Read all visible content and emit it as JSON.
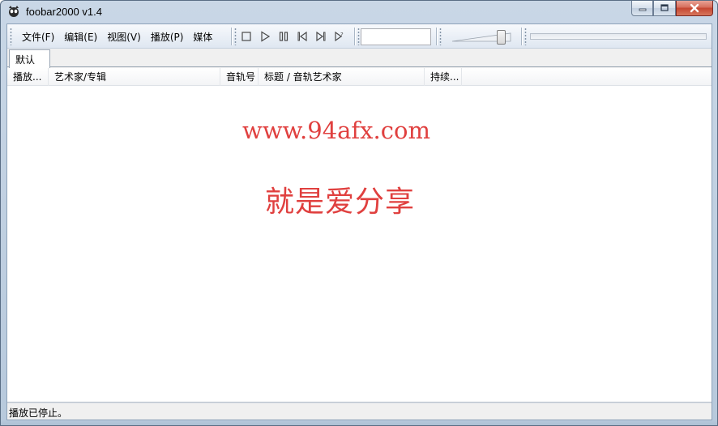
{
  "window": {
    "title": "foobar2000 v1.4"
  },
  "menu": {
    "items": [
      "文件(F)",
      "编辑(E)",
      "视图(V)",
      "播放(P)",
      "媒体"
    ]
  },
  "transport": {
    "buttons": [
      "stop-icon",
      "play-icon",
      "pause-icon",
      "previous-icon",
      "next-icon",
      "random-icon"
    ]
  },
  "volume": {
    "level": 0.85
  },
  "seek": {
    "position": 0
  },
  "tabs": [
    {
      "label": "默认",
      "active": true
    }
  ],
  "playlist": {
    "columns": [
      "播放...",
      "艺术家/专辑",
      "音轨号",
      "标题 / 音轨艺术家",
      "持续..."
    ],
    "rows": []
  },
  "watermark": {
    "url": "www.94afx.com",
    "slogan": "就是爱分享",
    "color": "#e0403f"
  },
  "status": {
    "text": "播放已停止。"
  }
}
